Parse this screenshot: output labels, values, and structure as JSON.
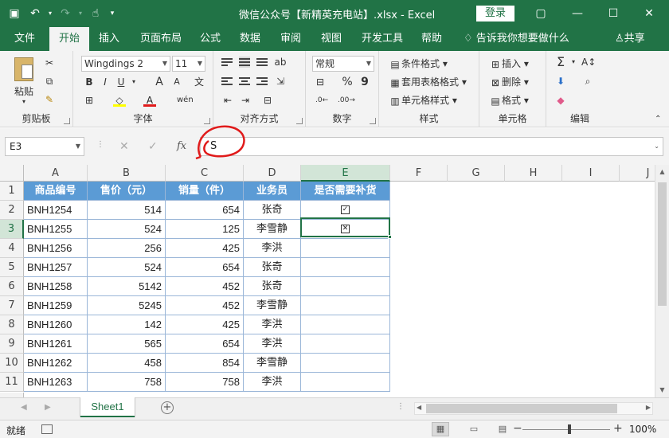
{
  "window": {
    "title": "微信公众号【新精英充电站】.xlsx  -  Excel",
    "login_label": "登录",
    "controls": [
      "▢",
      "—",
      "☐",
      "✕"
    ]
  },
  "tabs": [
    "文件",
    "开始",
    "插入",
    "页面布局",
    "公式",
    "数据",
    "审阅",
    "视图",
    "开发工具",
    "帮助"
  ],
  "active_tab": "开始",
  "tell_me": "告诉我你想要做什么",
  "share": "共享",
  "ribbon": {
    "clipboard": {
      "label": "剪贴板",
      "paste": "粘贴"
    },
    "font": {
      "label": "字体",
      "font_name": "Wingdings 2",
      "font_size": "11",
      "bold": "B",
      "italic": "I",
      "underline": "U"
    },
    "alignment": {
      "label": "对齐方式"
    },
    "number": {
      "label": "数字",
      "format": "常规",
      "percent": "%",
      "comma": "9"
    },
    "styles": {
      "label": "样式",
      "conditional": "条件格式",
      "table_format": "套用表格格式",
      "cell_styles": "单元格样式"
    },
    "cells": {
      "label": "单元格",
      "insert": "插入",
      "delete": "删除",
      "format": "格式"
    },
    "editing": {
      "label": "编辑"
    }
  },
  "formula_bar": {
    "name_box": "E3",
    "fx": "fx",
    "value": "S"
  },
  "columns": [
    "A",
    "B",
    "C",
    "D",
    "E",
    "F",
    "G",
    "H",
    "I",
    "J"
  ],
  "header_row": [
    "商品编号",
    "售价（元）",
    "销量（件）",
    "业务员",
    "是否需要补货"
  ],
  "rows": [
    {
      "n": "2",
      "a": "BNH1254",
      "b": "514",
      "c": "654",
      "d": "张奇",
      "e": "☑"
    },
    {
      "n": "3",
      "a": "BNH1255",
      "b": "524",
      "c": "125",
      "d": "李雪静",
      "e": "☒"
    },
    {
      "n": "4",
      "a": "BNH1256",
      "b": "256",
      "c": "425",
      "d": "李洪",
      "e": ""
    },
    {
      "n": "5",
      "a": "BNH1257",
      "b": "524",
      "c": "654",
      "d": "张奇",
      "e": ""
    },
    {
      "n": "6",
      "a": "BNH1258",
      "b": "5142",
      "c": "452",
      "d": "张奇",
      "e": ""
    },
    {
      "n": "7",
      "a": "BNH1259",
      "b": "5245",
      "c": "452",
      "d": "李雪静",
      "e": ""
    },
    {
      "n": "8",
      "a": "BNH1260",
      "b": "142",
      "c": "425",
      "d": "李洪",
      "e": ""
    },
    {
      "n": "9",
      "a": "BNH1261",
      "b": "565",
      "c": "654",
      "d": "李洪",
      "e": ""
    },
    {
      "n": "10",
      "a": "BNH1262",
      "b": "458",
      "c": "854",
      "d": "李雪静",
      "e": ""
    },
    {
      "n": "11",
      "a": "BNH1263",
      "b": "758",
      "c": "758",
      "d": "李洪",
      "e": ""
    }
  ],
  "row1_num": "1",
  "sheet": {
    "name": "Sheet1",
    "add": "+"
  },
  "status": {
    "ready": "就绪",
    "zoom": "100%",
    "minus": "−",
    "plus": "+"
  }
}
